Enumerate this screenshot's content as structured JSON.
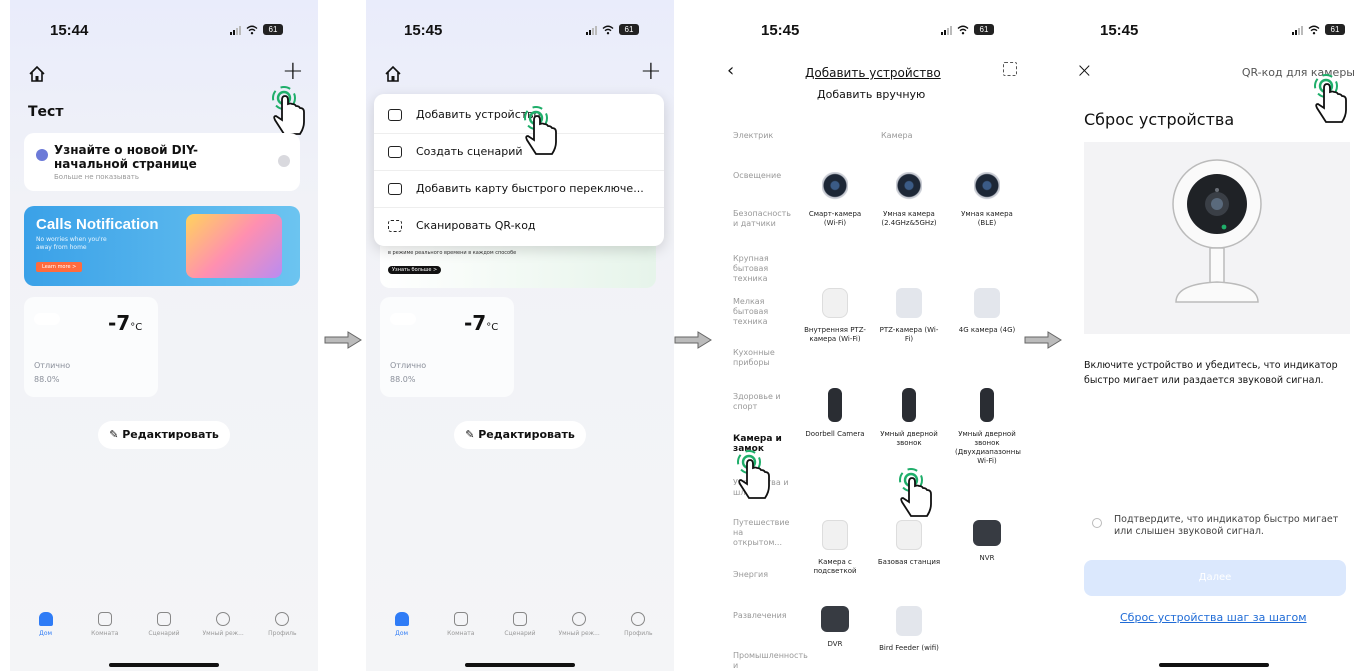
{
  "screens": [
    {
      "time": "15:44",
      "battery": "61",
      "home_title": "Тест",
      "promo_title": "Узнайте о новой DIY-начальной странице",
      "promo_sub": "Больше не показывать",
      "banner_title": "Calls Notification",
      "banner_sub": "No worries when you're away from home",
      "banner_button": "Learn more >",
      "temperature": "-7",
      "temp_unit": "°C",
      "weather_quality": "Отлично",
      "humidity": "88.0%",
      "edit_label": "Редактировать",
      "tabs": [
        "Дом",
        "Комната",
        "Сценарий",
        "Умный реж...",
        "Профиль"
      ]
    },
    {
      "time": "15:45",
      "battery": "61",
      "menu": [
        "Добавить устройство",
        "Создать сценарий",
        "Добавить карту быстрого переключе...",
        "Сканировать QR-код"
      ],
      "banner_snippet": "в режиме реального времени в каждом способе",
      "banner_snippet2": "Узнать больше >",
      "temperature": "-7",
      "temp_unit": "°C",
      "weather_quality": "Отлично",
      "humidity": "88.0%",
      "edit_label": "Редактировать",
      "tabs": [
        "Дом",
        "Комната",
        "Сценарий",
        "Умный реж...",
        "Профиль"
      ]
    },
    {
      "time": "15:45",
      "battery": "61",
      "title": "Добавить устройство",
      "subtitle": "Добавить вручную",
      "categories": [
        "Электрик",
        "Освещение",
        "Безопасность и датчики",
        "Крупная бытовая техника",
        "Мелкая бытовая техника",
        "Кухонные приборы",
        "Здоровье и спорт",
        "Камера и замок",
        "Устройства и шлюзы",
        "Путешествие на открытом...",
        "Энергия",
        "Развлечения",
        "Промышленность и"
      ],
      "col_header": "Камера",
      "devices": [
        "Смарт-камера (Wi-Fi)",
        "Умная камера (2.4GHz&5GHz)",
        "Умная камера (BLE)",
        "Внутренняя PTZ-камера (Wi-Fi)",
        "PTZ-камера (Wi-Fi)",
        "4G камера (4G)",
        "Doorbell Camera",
        "Умный дверной звонок",
        "Умный дверной звонок (Двухдиапазонный Wi-Fi)",
        "Камера с подсветкой",
        "Базовая станция",
        "NVR",
        "DVR",
        "Bird Feeder (wifi)"
      ]
    },
    {
      "time": "15:45",
      "battery": "61",
      "close": "×",
      "qr_label": "QR-код для камеры",
      "title": "Сброс устройства",
      "description": "Включите устройство и убедитесь, что индикатор быстро мигает или раздается звуковой сигнал.",
      "confirm": "Подтвердите, что индикатор быстро мигает или слышен звуковой сигнал.",
      "next_button": "Далее",
      "guide_link": "Сброс устройства шаг за шагом"
    }
  ],
  "colors": {
    "accent": "#2f7cf6",
    "tap_ring": "#1fae6a",
    "link": "#1f6bd6"
  }
}
